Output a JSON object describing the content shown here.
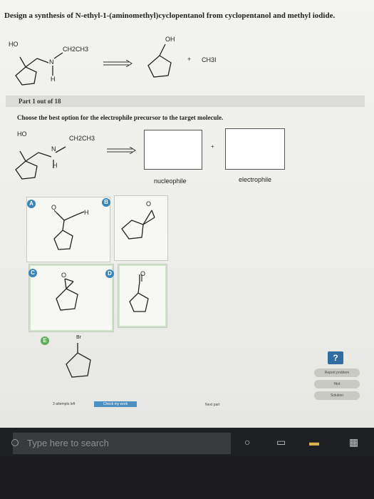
{
  "question": {
    "title": "Design a synthesis of N-ethyl-1-(aminomethyl)cyclopentanol from cyclopentanol and methyl iodide.",
    "reactant_target": {
      "ho": "HO",
      "n": "N",
      "h": "H",
      "ethyl": "CH2CH3"
    },
    "reactant_start": {
      "oh": "OH",
      "plus": "+",
      "reagent": "CH3I"
    }
  },
  "part": {
    "label": "Part 1 out of 18"
  },
  "instruction": "Choose the best option for the electrophile precursor to the target molecule.",
  "scheme": {
    "ho": "HO",
    "n": "N",
    "h": "H",
    "ethyl": "CH2CH3",
    "plus": "+",
    "nucleophile_label": "nucleophile",
    "electrophile_label": "electrophile"
  },
  "options": [
    {
      "letter": "A",
      "o": "O",
      "h": "H"
    },
    {
      "letter": "B",
      "o": "O"
    },
    {
      "letter": "C",
      "o": "O"
    },
    {
      "letter": "D",
      "o": "O"
    },
    {
      "letter": "E",
      "br": "Br"
    }
  ],
  "side_panel": {
    "help": "?",
    "report": "Report problem",
    "hint": "Hint",
    "solution": "Solution"
  },
  "footer": {
    "attempts": "3 attempts left",
    "check": "Check my work",
    "next": "Next part"
  },
  "taskbar": {
    "search_placeholder": "Type here to search"
  },
  "colors": {
    "badge_blue": "#3a86b8",
    "badge_green": "#5fae5a",
    "check_blue": "#4d8fc0"
  }
}
